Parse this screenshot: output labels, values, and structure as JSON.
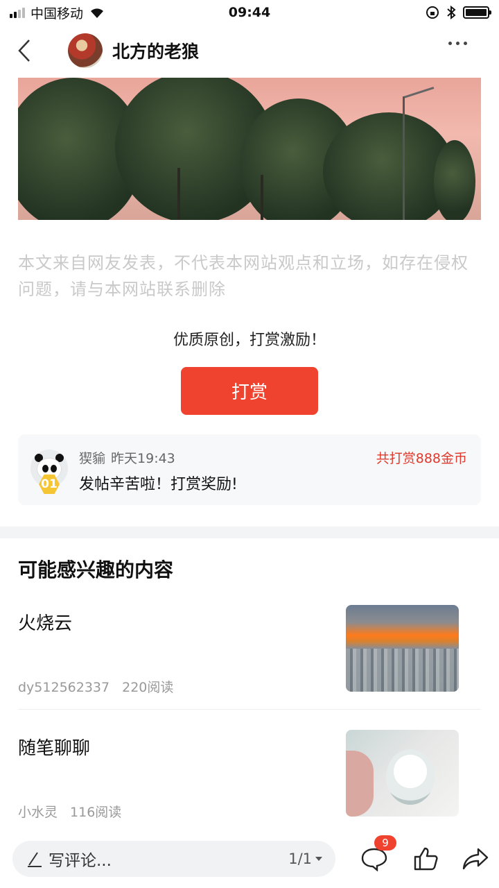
{
  "status_bar": {
    "carrier": "中国移动",
    "time": "09:44"
  },
  "nav": {
    "author_name": "北方的老狼"
  },
  "article": {
    "disclaimer": "本文来自网友发表，不代表本网站观点和立场，如存在侵权问题，请与本网站联系删除",
    "reward_tip": "优质原创，打赏激励！",
    "reward_button": "打赏"
  },
  "reward_record": {
    "user": "猰貐",
    "time": "昨天19:43",
    "total": "共打赏888金币",
    "message": "发帖辛苦啦！打赏奖励!",
    "rank": "01"
  },
  "recommend": {
    "title": "可能感兴趣的内容",
    "items": [
      {
        "title": "火烧云",
        "author": "dy512562337",
        "reads": "220阅读"
      },
      {
        "title": "随笔聊聊",
        "author": "小水灵",
        "reads": "116阅读"
      }
    ]
  },
  "bottom_bar": {
    "comment_placeholder": "写评论...",
    "page": "1/1",
    "comment_count": "9"
  },
  "colors": {
    "accent": "#f0432f",
    "reward_text": "#e0392c"
  },
  "icons": [
    "back-icon",
    "more-icon",
    "pencil-icon",
    "comment-icon",
    "like-icon",
    "share-icon",
    "wifi-icon",
    "lock-rotation-icon",
    "bluetooth-icon",
    "battery-icon"
  ]
}
